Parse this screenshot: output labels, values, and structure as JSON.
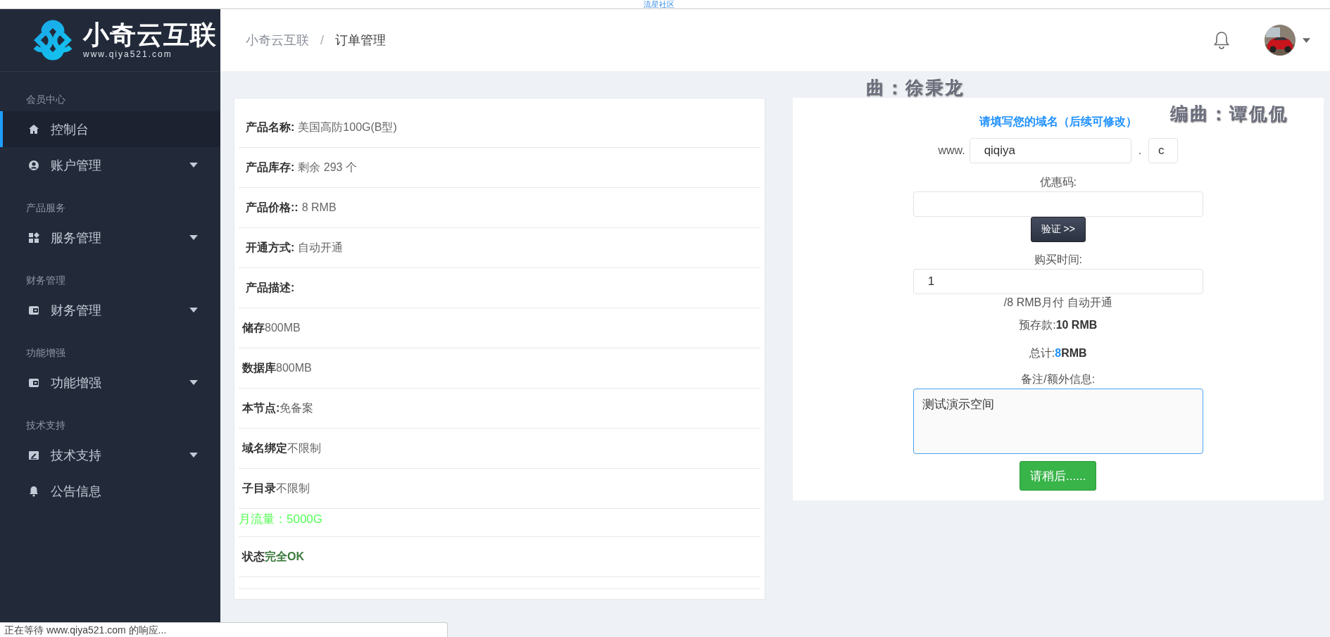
{
  "top_strip": {
    "text": "流星社区"
  },
  "brand": {
    "name": "小奇云互联",
    "url": "www.qiya521.com"
  },
  "sidebar": {
    "groups": [
      {
        "heading": "会员中心",
        "items": [
          {
            "label": "控制台",
            "selected": true,
            "expandable": false
          },
          {
            "label": "账户管理",
            "selected": false,
            "expandable": true
          }
        ]
      },
      {
        "heading": "产品服务",
        "items": [
          {
            "label": "服务管理",
            "selected": false,
            "expandable": true
          }
        ]
      },
      {
        "heading": "财务管理",
        "items": [
          {
            "label": "财务管理",
            "selected": false,
            "expandable": true
          }
        ]
      },
      {
        "heading": "功能增强",
        "items": [
          {
            "label": "功能增强",
            "selected": false,
            "expandable": true
          }
        ]
      },
      {
        "heading": "技术支持",
        "items": [
          {
            "label": "技术支持",
            "selected": false,
            "expandable": true
          },
          {
            "label": "公告信息",
            "selected": false,
            "expandable": false
          }
        ]
      }
    ]
  },
  "breadcrumb": {
    "items": [
      "小奇云互联",
      "订单管理"
    ],
    "separator": "/"
  },
  "product": {
    "rows": [
      {
        "kind": "field",
        "label": "产品名称:",
        "value": "美国高防100G(B型)"
      },
      {
        "kind": "field",
        "label": "产品库存:",
        "value": "剩余 293 个"
      },
      {
        "kind": "field",
        "label": "产品价格::",
        "value": "8 RMB"
      },
      {
        "kind": "field",
        "label": "开通方式:",
        "value": "自动开通"
      },
      {
        "kind": "field",
        "label": "产品描述:"
      },
      {
        "kind": "plain",
        "label": "储存",
        "value": "800MB"
      },
      {
        "kind": "plain",
        "label": "数据库",
        "value": "800MB"
      },
      {
        "kind": "plain",
        "label": "本节点:",
        "value": "免备案"
      },
      {
        "kind": "plain",
        "label": "域名绑定",
        "value": "不限制"
      },
      {
        "kind": "plain",
        "label": "子目录",
        "value": "不限制"
      },
      {
        "kind": "notice",
        "value": "月流量：5000G"
      },
      {
        "kind": "status",
        "label": "状态",
        "value": "完全OK"
      }
    ]
  },
  "order": {
    "heading": "请填写您的域名（后续可修改）",
    "domain": {
      "prefix": "www.",
      "name": "qiqiya",
      "dot": ".",
      "suffix": "c"
    },
    "coupon": {
      "label": "优惠码:",
      "button": "验证 >>"
    },
    "duration": {
      "label": "购买时间:",
      "value": "1",
      "note": "/8 RMB月付 自动开通"
    },
    "deposit": "预存款:**10 RMB**",
    "total": {
      "label": "总计:",
      "amount": "8",
      "unit": "RMB"
    },
    "notes": {
      "label": "备注/额外信息:",
      "value": "测试演示空间",
      "focused": true
    },
    "submit": "请稍后......"
  },
  "desktop_lyrics": [
    "曲：徐秉龙",
    "编曲：谭侃侃"
  ],
  "status_bar": "正在等待 www.qiya521.com 的响应..."
}
